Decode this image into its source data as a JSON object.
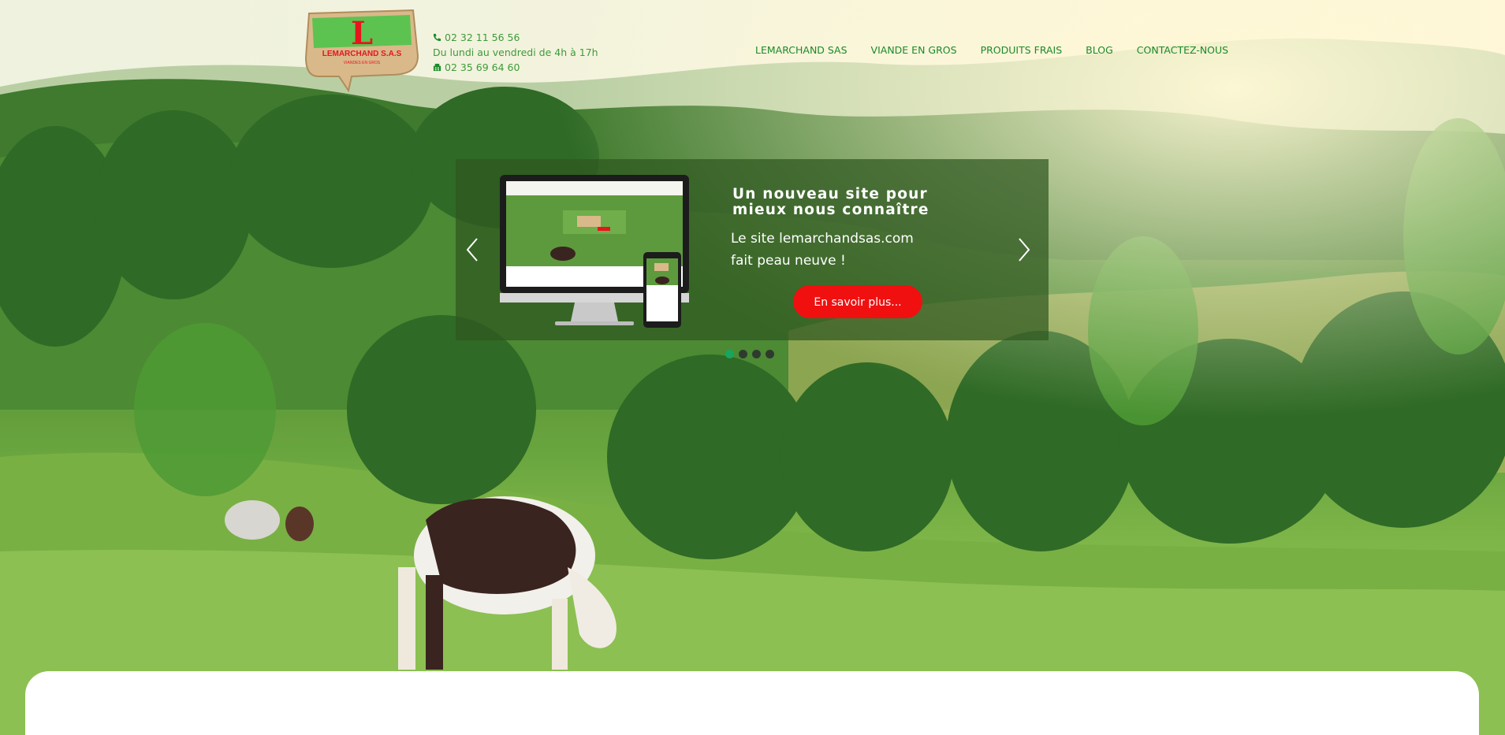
{
  "brand": {
    "logo_letter": "L",
    "logo_name": "LEMARCHAND S.A.S",
    "logo_tagline": "VIANDES EN GROS",
    "colors": {
      "green": "#1b8a2a",
      "red": "#e8141d",
      "cta": "#f01010",
      "dot_active": "#17a660"
    }
  },
  "contact": {
    "phone": "02 32 11 56 56",
    "hours": "Du lundi au vendredi de 4h à 17h",
    "fax": "02 35 69 64 60",
    "phone_icon": "phone-icon",
    "fax_icon": "fax-icon"
  },
  "nav": {
    "items": [
      "LEMARCHAND SAS",
      "VIANDE EN GROS",
      "PRODUITS FRAIS",
      "BLOG",
      "CONTACTEZ-NOUS"
    ]
  },
  "carousel": {
    "title": "Un nouveau site pour mieux nous connaître",
    "text": "Le site lemarchandsas.com fait peau neuve !",
    "button": "En savoir plus...",
    "prev_icon": "chevron-left-icon",
    "next_icon": "chevron-right-icon",
    "active_slide": 1,
    "slide_count": 4
  }
}
